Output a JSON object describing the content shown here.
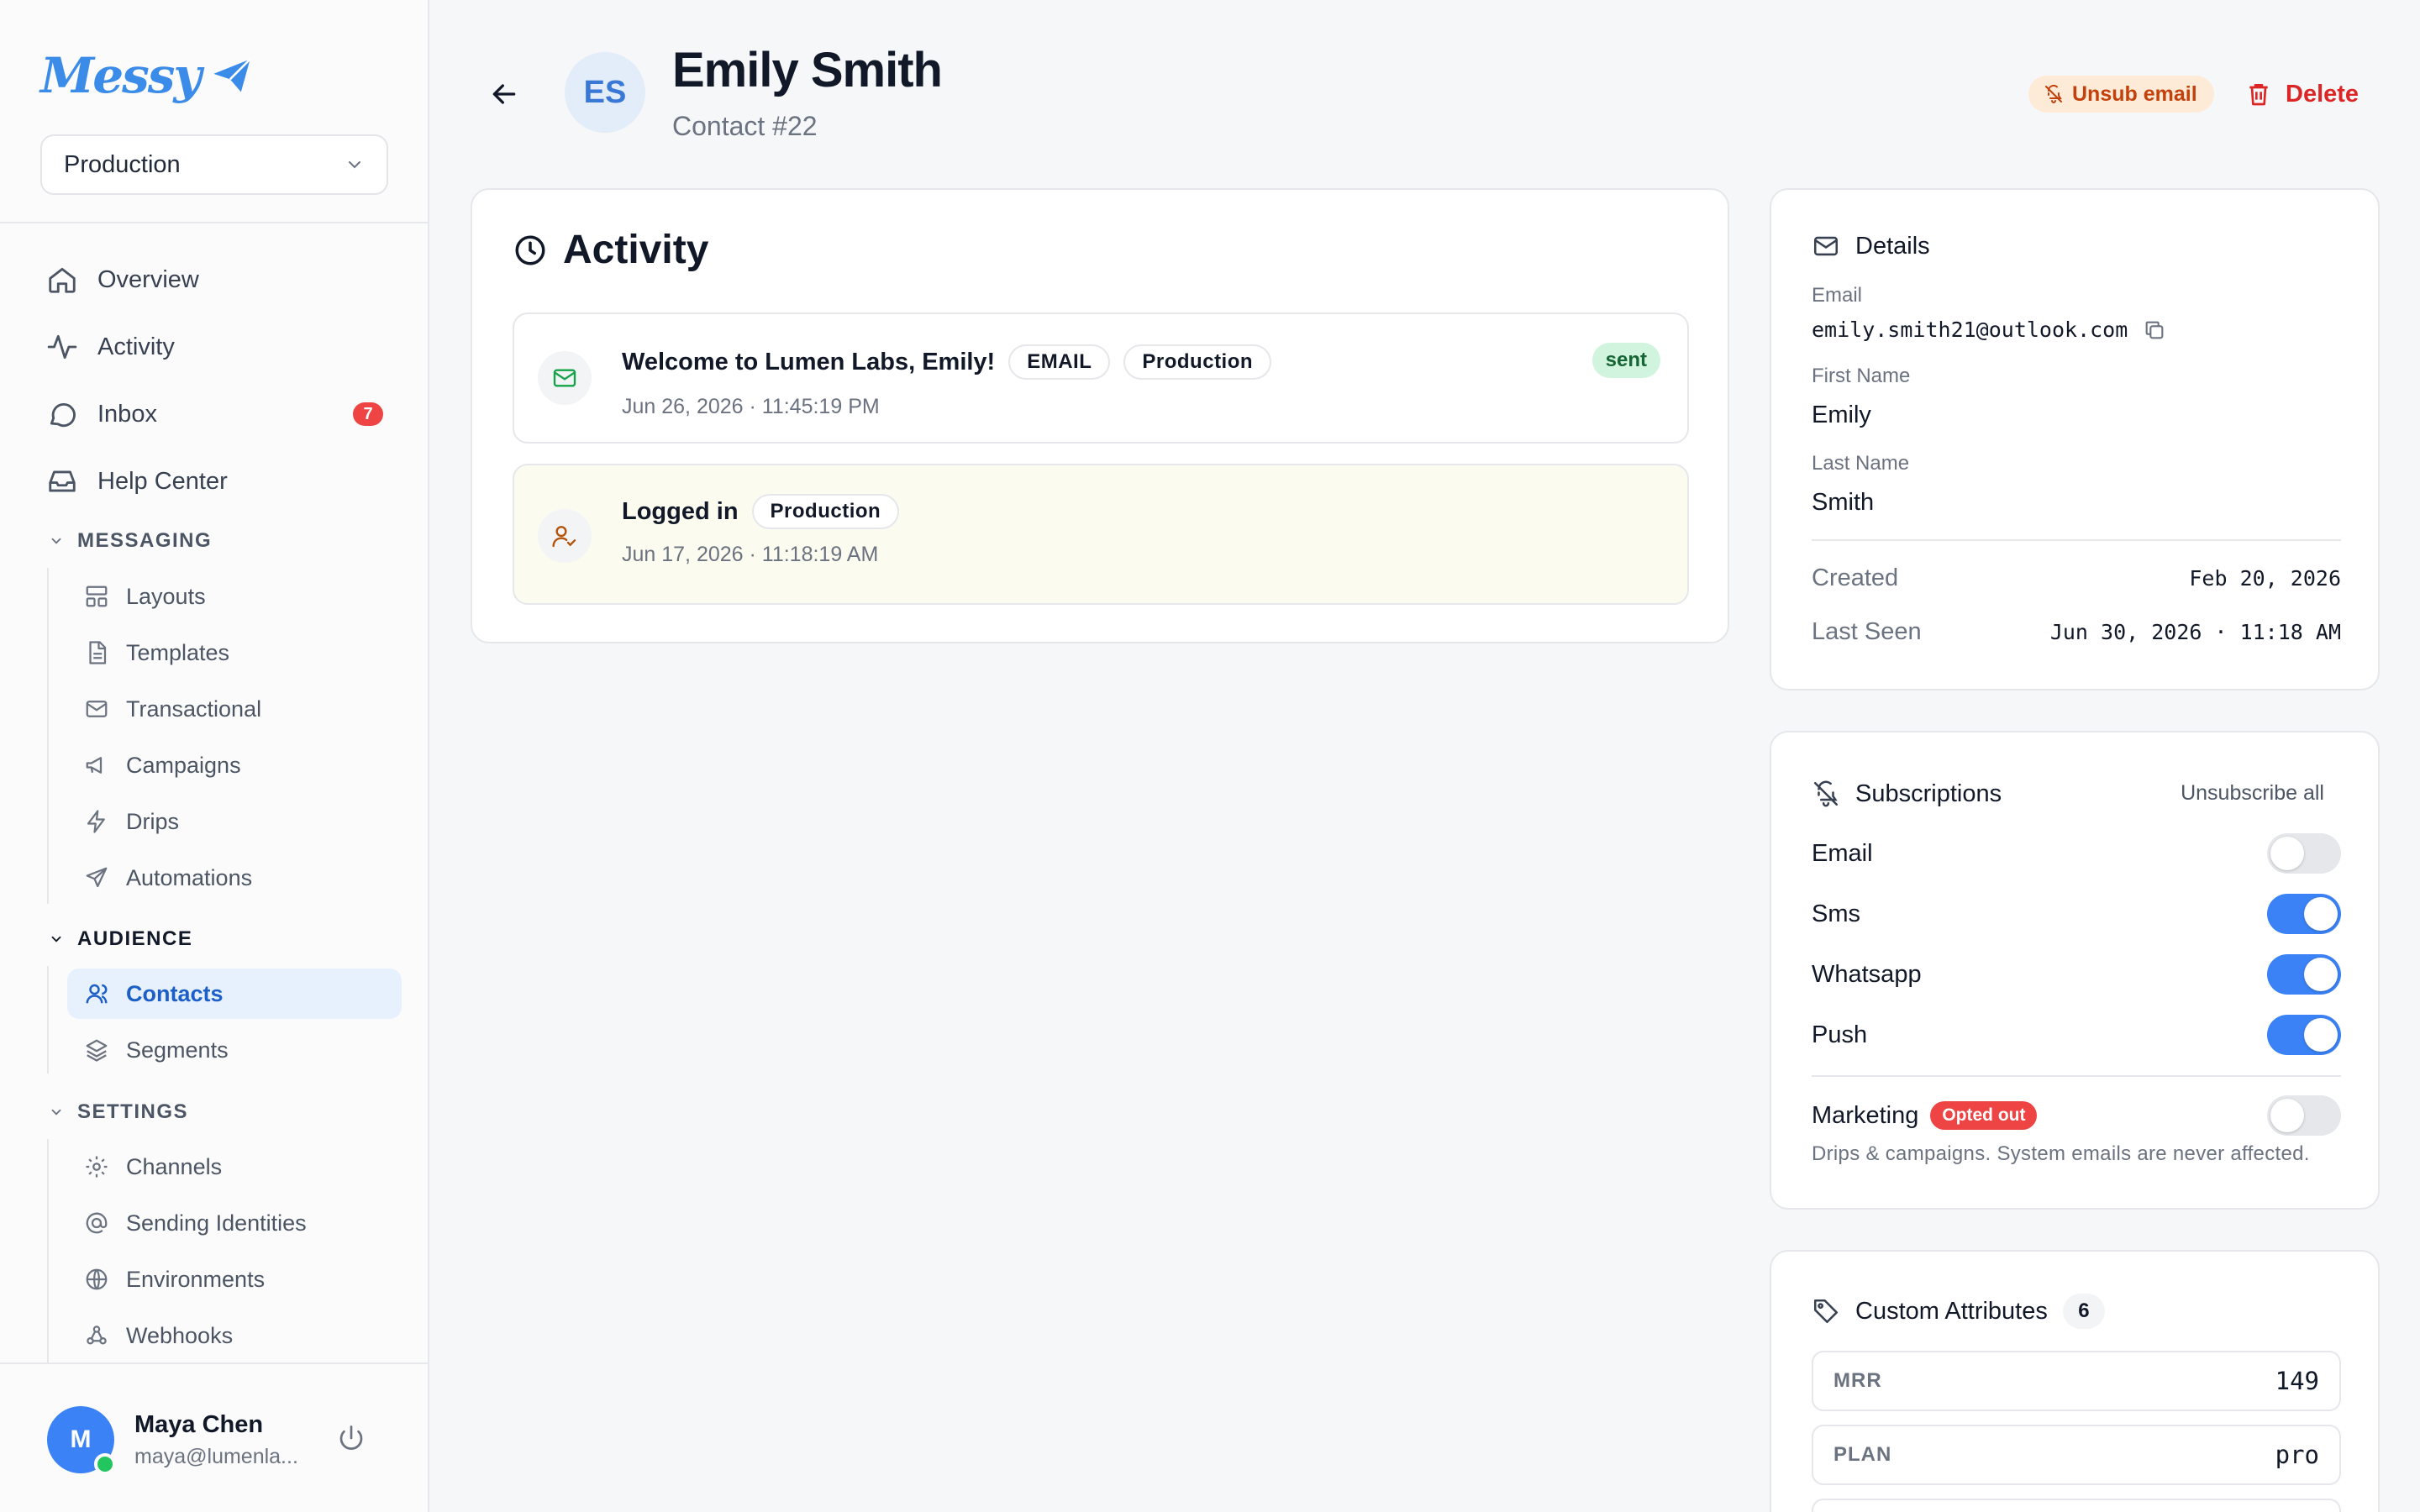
{
  "brand": {
    "logo_text": "Messy"
  },
  "environment_select": {
    "value": "Production"
  },
  "nav": {
    "main": [
      {
        "label": "Overview"
      },
      {
        "label": "Activity"
      },
      {
        "label": "Inbox",
        "badge": "7"
      },
      {
        "label": "Help Center"
      }
    ],
    "sections": [
      {
        "title": "MESSAGING",
        "items": [
          "Layouts",
          "Templates",
          "Transactional",
          "Campaigns",
          "Drips",
          "Automations"
        ]
      },
      {
        "title": "AUDIENCE",
        "items": [
          "Contacts",
          "Segments"
        ]
      },
      {
        "title": "SETTINGS",
        "items": [
          "Channels",
          "Sending Identities",
          "Environments",
          "Webhooks"
        ]
      }
    ]
  },
  "user": {
    "initial": "M",
    "name": "Maya Chen",
    "email": "maya@lumenla..."
  },
  "contact": {
    "initials": "ES",
    "name": "Emily Smith",
    "id_label": "Contact #22",
    "unsub_label": "Unsub email",
    "delete_label": "Delete"
  },
  "activity": {
    "title": "Activity",
    "events": [
      {
        "title": "Welcome to Lumen Labs, Emily!",
        "tags": [
          "EMAIL",
          "Production"
        ],
        "time": "Jun 26, 2026 · 11:45:19 PM",
        "status": "sent"
      },
      {
        "title": "Logged in",
        "tags": [
          "Production"
        ],
        "time": "Jun 17, 2026 · 11:18:19 AM"
      }
    ]
  },
  "details": {
    "title": "Details",
    "email_label": "Email",
    "email": "emily.smith21@outlook.com",
    "first_name_label": "First Name",
    "first_name": "Emily",
    "last_name_label": "Last Name",
    "last_name": "Smith",
    "created_label": "Created",
    "created": "Feb 20, 2026",
    "last_seen_label": "Last Seen",
    "last_seen": "Jun 30, 2026 · 11:18 AM"
  },
  "subscriptions": {
    "title": "Subscriptions",
    "unsubscribe_all": "Unsubscribe all",
    "channels": [
      {
        "label": "Email",
        "on": false
      },
      {
        "label": "Sms",
        "on": true
      },
      {
        "label": "Whatsapp",
        "on": true
      },
      {
        "label": "Push",
        "on": true
      }
    ],
    "marketing": {
      "label": "Marketing",
      "badge": "Opted out",
      "on": false
    },
    "note": "Drips & campaigns. System emails are never affected."
  },
  "custom_attributes": {
    "title": "Custom Attributes",
    "count": "6",
    "items": [
      {
        "key": "MRR",
        "value": "149"
      },
      {
        "key": "PLAN",
        "value": "pro"
      }
    ]
  },
  "colors": {
    "accent": "#3b82f6",
    "danger": "#ef4444",
    "success_bg": "#d1f4df"
  }
}
